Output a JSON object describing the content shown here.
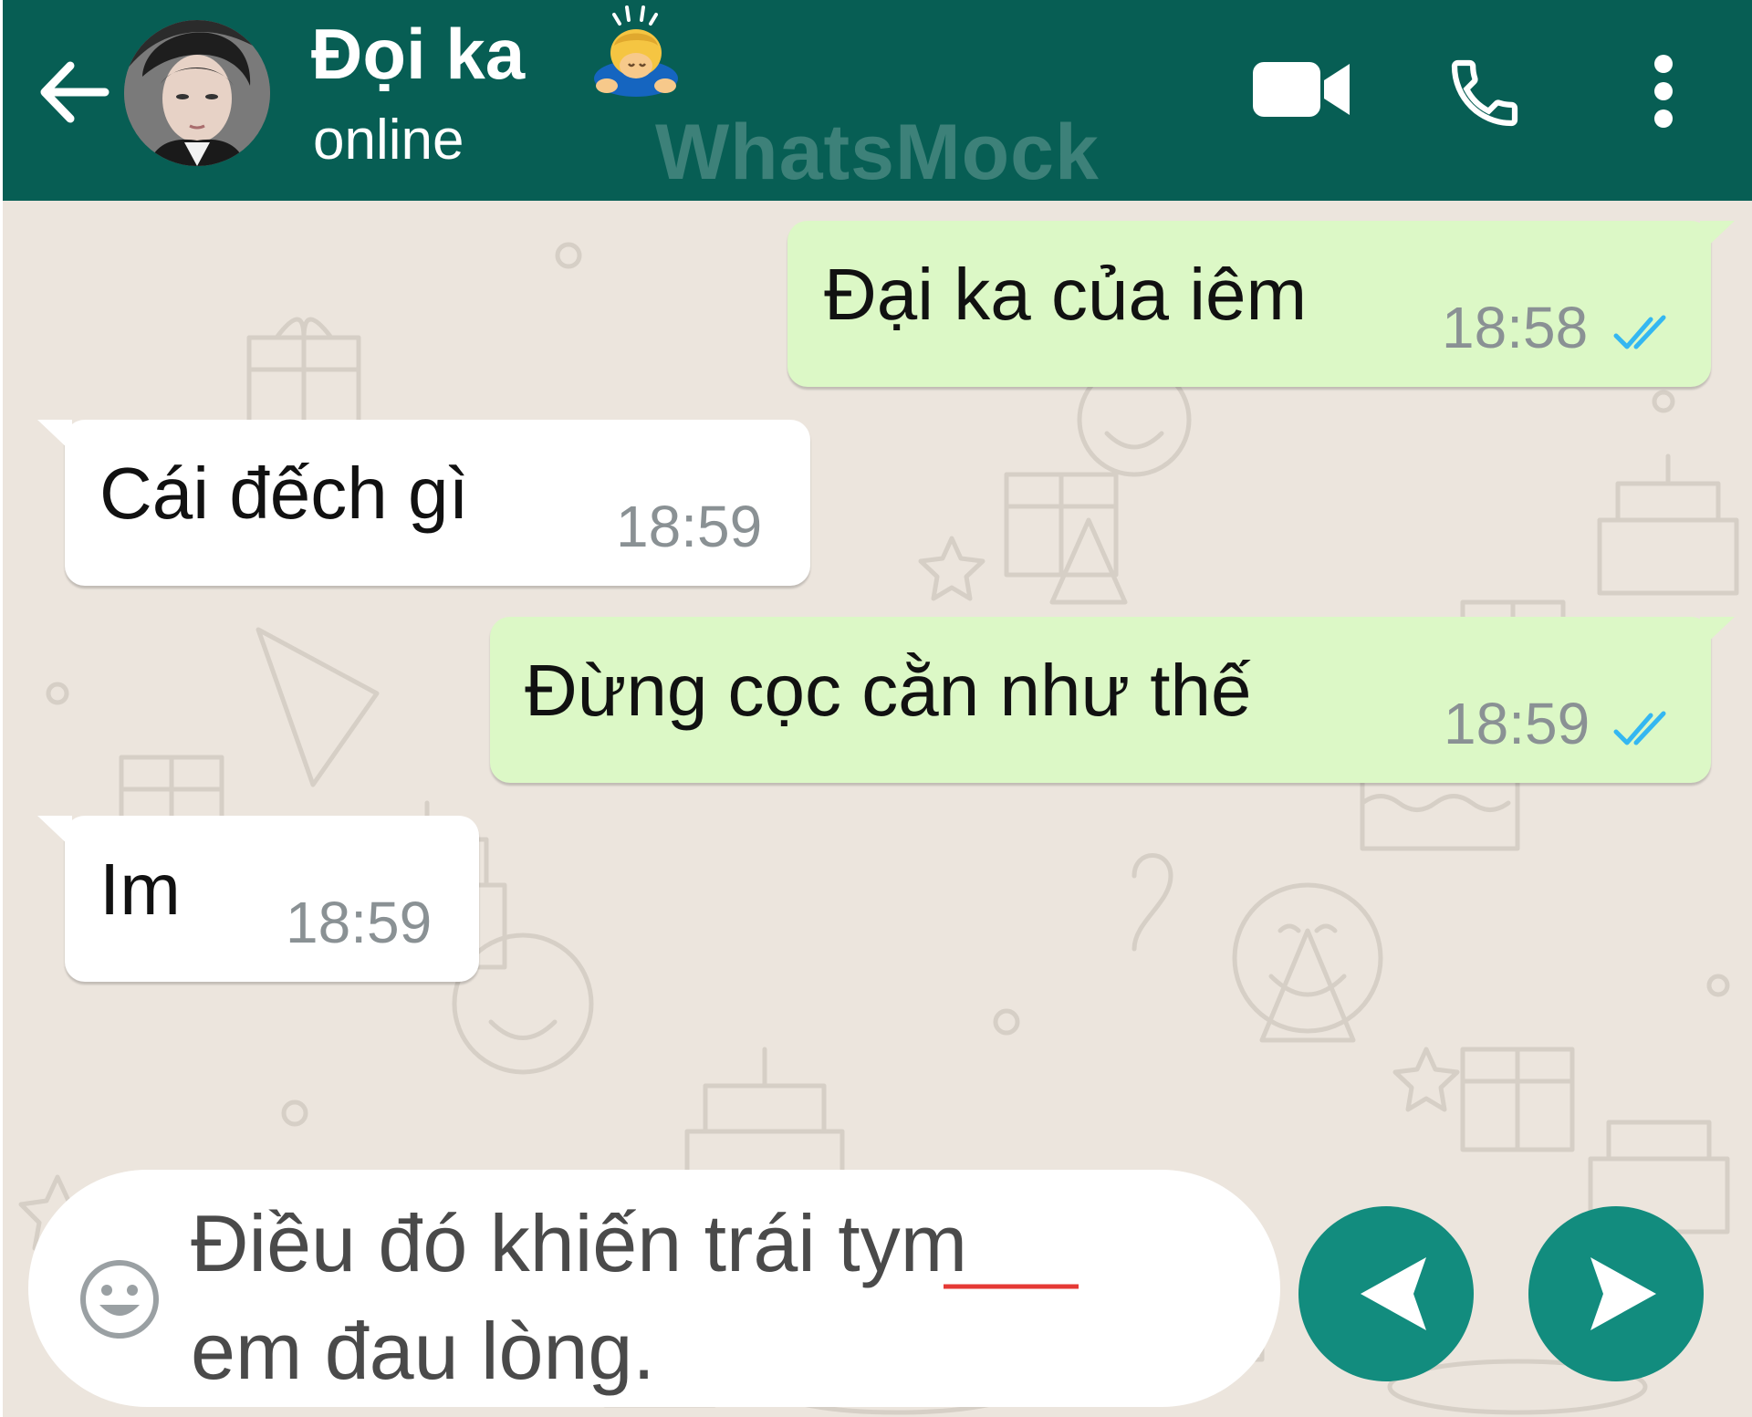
{
  "header": {
    "contact_name": "Đọi ka",
    "status": "online",
    "watermark": "WhatsMock"
  },
  "messages": [
    {
      "direction": "outgoing",
      "text": "Đại ka của iêm",
      "time": "18:58",
      "ticks": "read"
    },
    {
      "direction": "incoming",
      "text": "Cái đếch gì",
      "time": "18:59"
    },
    {
      "direction": "outgoing",
      "text": "Đừng cọc cằn như thế",
      "time": "18:59",
      "ticks": "read"
    },
    {
      "direction": "incoming",
      "text": "Im",
      "time": "18:59"
    }
  ],
  "composer": {
    "text": "Điều đó khiến trái tym\nem đau lòng."
  },
  "icons": {
    "back": "arrow-left-icon",
    "video": "video-camera-icon",
    "call": "phone-icon",
    "menu": "more-vertical-icon",
    "emoji": "smiley-icon",
    "prev": "triangle-left-icon",
    "send": "send-icon",
    "read_ticks": "double-check-icon"
  },
  "colors": {
    "header": "#075e54",
    "chat_background": "#ece5dd",
    "outgoing_bubble": "#dcf8c6",
    "incoming_bubble": "#ffffff",
    "read_tick": "#34b7f1",
    "action_button": "#128c7e",
    "spellcheck_underline": "#e53935"
  }
}
